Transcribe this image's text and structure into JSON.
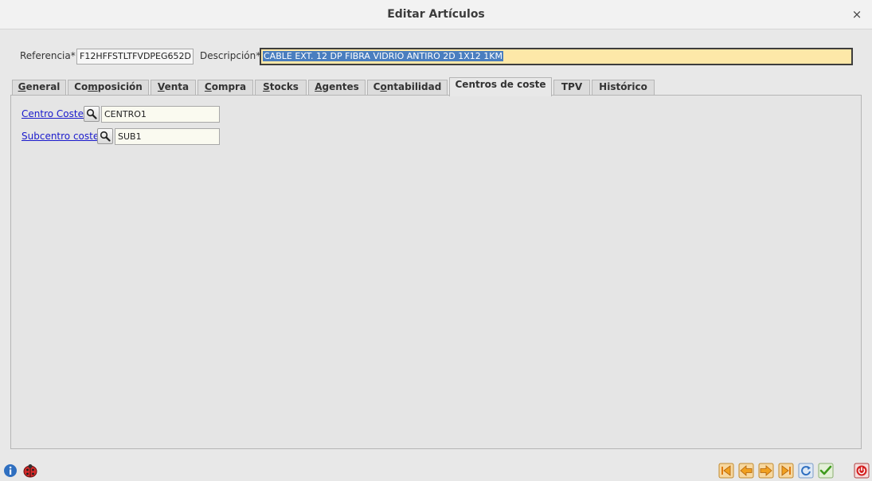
{
  "window": {
    "title": "Editar Artículos",
    "close_glyph": "×"
  },
  "header": {
    "referencia_label": "Referencia*",
    "referencia_value": "F12HFFSTLTFVDPEG652D",
    "descripcion_label": "Descripción*",
    "descripcion_value": "CABLE EXT. 12 DP FIBRA VIDRIO ANTIRO 2D 1X12 1KM"
  },
  "tabs": [
    {
      "pre": "",
      "ul": "G",
      "post": "eneral"
    },
    {
      "pre": "Co",
      "ul": "m",
      "post": "posición"
    },
    {
      "pre": "",
      "ul": "V",
      "post": "enta"
    },
    {
      "pre": "",
      "ul": "C",
      "post": "ompra"
    },
    {
      "pre": "",
      "ul": "S",
      "post": "tocks"
    },
    {
      "pre": "",
      "ul": "A",
      "post": "gentes"
    },
    {
      "pre": "C",
      "ul": "o",
      "post": "ntabilidad"
    },
    {
      "pre": "Centros de coste",
      "ul": "",
      "post": ""
    },
    {
      "pre": "TPV",
      "ul": "",
      "post": ""
    },
    {
      "pre": "Histórico",
      "ul": "",
      "post": ""
    }
  ],
  "active_tab": "Centros de coste",
  "centros": {
    "centro_label": "Centro Coste",
    "centro_value": "CENTRO1",
    "subcentro_label": "Subcentro coste",
    "subcentro_value": "SUB1"
  },
  "icons": {
    "info": "info-icon",
    "bug": "ladybug-icon",
    "search": "magnifier-icon",
    "first": "first-record-icon",
    "prev": "previous-record-icon",
    "next": "next-record-icon",
    "last": "last-record-icon",
    "refresh": "refresh-icon",
    "accept": "checkmark-icon",
    "exit": "power-icon"
  },
  "colors": {
    "accent_selection": "#4a7ebf",
    "required_field": "#fde8a8",
    "link": "#1a1acc",
    "nav_arrow": "#f0a020",
    "exit_red": "#d42020"
  }
}
